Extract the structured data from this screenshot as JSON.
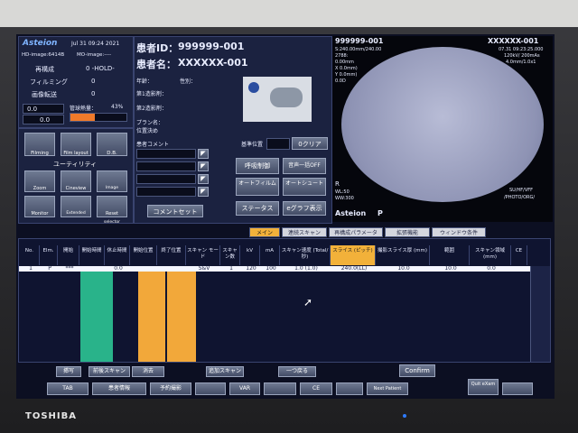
{
  "app": {
    "logo": "Asteion",
    "date_time": "Jul 31 09:24 2021"
  },
  "left_info": {
    "rows": [
      {
        "label": "HD-image:6414B",
        "value": "MO-image:----"
      },
      {
        "label": "再構成",
        "value": "0 -HOLD-"
      },
      {
        "label": "フィルミング",
        "value": "0"
      },
      {
        "label": "画像転送",
        "value": "0"
      }
    ],
    "value_a": "0.0",
    "value_b": "0.0",
    "tube_label": "管球熱量：",
    "tube_value": "43%",
    "tube_fill": 0.43
  },
  "function_buttons": [
    {
      "label": "Filming"
    },
    {
      "label": "Film layout"
    },
    {
      "label": "D.B."
    }
  ],
  "utility_title": "ユーティリティ",
  "utility_buttons": [
    {
      "label": "Zoom"
    },
    {
      "label": "Cineview"
    },
    {
      "label": "Image selector"
    },
    {
      "label": "Monitor"
    },
    {
      "label": "Extended mode"
    },
    {
      "label": "Reset"
    }
  ],
  "patient": {
    "id_label": "患者ID：",
    "id_value": "999999-001",
    "name_label": "患者名：",
    "name_value": "XXXXXX-001",
    "age_label": "年齢：",
    "sex_label": "性別：",
    "contrast1_label": "第1造影剤：",
    "contrast2_label": "第2造影剤：",
    "plan_label": "プラン名：",
    "position_label": "位置決め",
    "comment_label": "患者コメント",
    "comment_set": "コメントセット"
  },
  "controls": {
    "base_position_label": "基準位置",
    "zero_clear": "0クリア",
    "breath": "呼吸制御",
    "voice_off": "音声一括OFF",
    "auto_film": "オートフィルム",
    "auto_shoot": "オートシュート",
    "status": "ステータス",
    "egraph": "eグラフ表示"
  },
  "image_panel": {
    "top_left_id": "999999-001",
    "top_right_id": "XXXXXX-001",
    "left_lines": [
      "S:240.00mm/240.00",
      "2788:",
      "0.00mm",
      "X 0.0mm)",
      "Y 0.0mm)",
      "0.0D"
    ],
    "right_lines": [
      "07.31 09:23:25.000",
      "120kV/ 200mAs",
      "4.0mm/1.0x1"
    ],
    "r_marker": "R",
    "wl_label": "WL:50",
    "ww_label": "WW:300",
    "su_label": "SU/HF/VFF",
    "photo_label": "/PHOTO/ORG/",
    "brand_label": "Asteion",
    "p_marker": "P"
  },
  "tabs": [
    {
      "label": "メイン",
      "active": true
    },
    {
      "label": "連続スキャン",
      "active": false
    },
    {
      "label": "再構成パラメータ",
      "active": false
    },
    {
      "label": "拡張機能",
      "active": false
    },
    {
      "label": "ウィンドウ条件",
      "active": false
    }
  ],
  "table": {
    "headers": [
      "No.",
      "Elm.",
      "開始",
      "開始時間",
      "休止時間",
      "開始位置",
      "終了位置",
      "スキャン モード",
      "スキャン数",
      "kV",
      "mA",
      "スキャン速度 (Total/秒)",
      "スライス (ピッチ)",
      "撮影スライス厚 (mm)",
      "範囲",
      "スキャン領域 (mm)",
      "CE"
    ],
    "row": [
      "1",
      "P",
      "***",
      "",
      "0.0",
      "",
      "",
      "S&V",
      "1",
      "120",
      "100",
      "1.0 (1.0)",
      "240.0(LL)",
      "10.0",
      "10.0",
      "0.0",
      ""
    ]
  },
  "bottom_buttons_row1": [
    {
      "label": "挿写"
    },
    {
      "label": "前後スキャン"
    },
    {
      "label": "消去"
    },
    {
      "label": "追加スキャン"
    },
    {
      "label": "一つ戻る"
    },
    {
      "label": "Confirm"
    }
  ],
  "bottom_buttons_row2": [
    {
      "label": "TAB"
    },
    {
      "label": "患者情報"
    },
    {
      "label": "予約撮影"
    },
    {
      "label": ""
    },
    {
      "label": "VAR"
    },
    {
      "label": ""
    },
    {
      "label": "CE"
    },
    {
      "label": ""
    },
    {
      "label": "Next Patient"
    },
    {
      "label": "Quit eXam"
    },
    {
      "label": ""
    }
  ],
  "monitor_brand": "TOSHIBA",
  "colors": {
    "green_band": "#29b38a",
    "orange_band": "#f2a83a",
    "tube_bar": "#f07a2a",
    "active_tab": "#f2b13a"
  }
}
